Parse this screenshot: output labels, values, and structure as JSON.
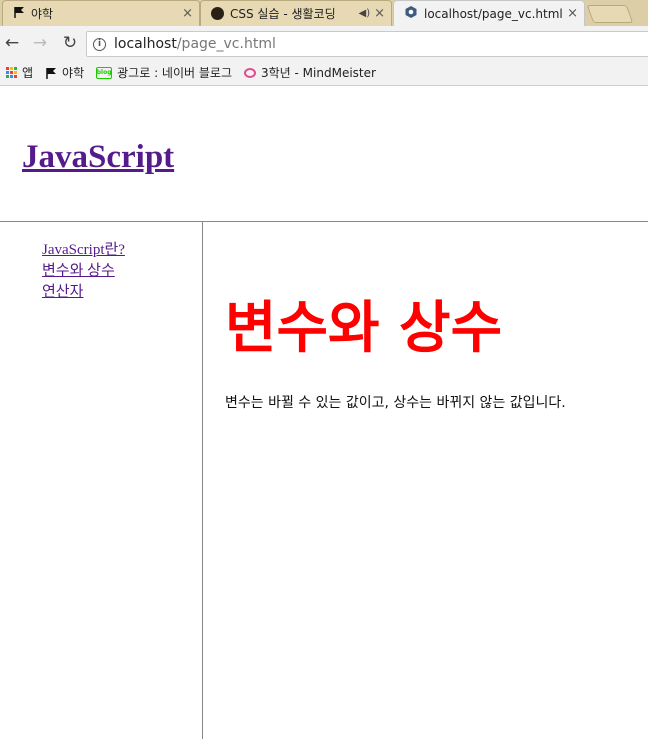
{
  "browser": {
    "tabs": [
      {
        "label": "야학",
        "active": false
      },
      {
        "label": "CSS 실습 - 생활코딩",
        "active": false
      },
      {
        "label": "localhost/page_vc.html",
        "active": true
      }
    ],
    "close_glyph": "×",
    "url_host": "localhost",
    "url_path": "/page_vc.html"
  },
  "bookmarks": [
    {
      "label": "앱",
      "icon": "apps-grid-icon"
    },
    {
      "label": "야학",
      "icon": "flag-icon"
    },
    {
      "label": "광그로 : 네이버 블로그",
      "icon": "blog-icon"
    },
    {
      "label": "3학년 - MindMeister",
      "icon": "mindmeister-icon"
    }
  ],
  "site": {
    "title": "JavaScript"
  },
  "nav": [
    {
      "label": "JavaScript란?"
    },
    {
      "label": "변수와 상수"
    },
    {
      "label": "연산자"
    }
  ],
  "article": {
    "title": "변수와 상수",
    "body": "변수는 바뀔 수 있는 값이고, 상수는 바뀌지 않는 값입니다."
  },
  "colors": {
    "link_visited": "#551a8b",
    "heading": "#ff0000"
  }
}
